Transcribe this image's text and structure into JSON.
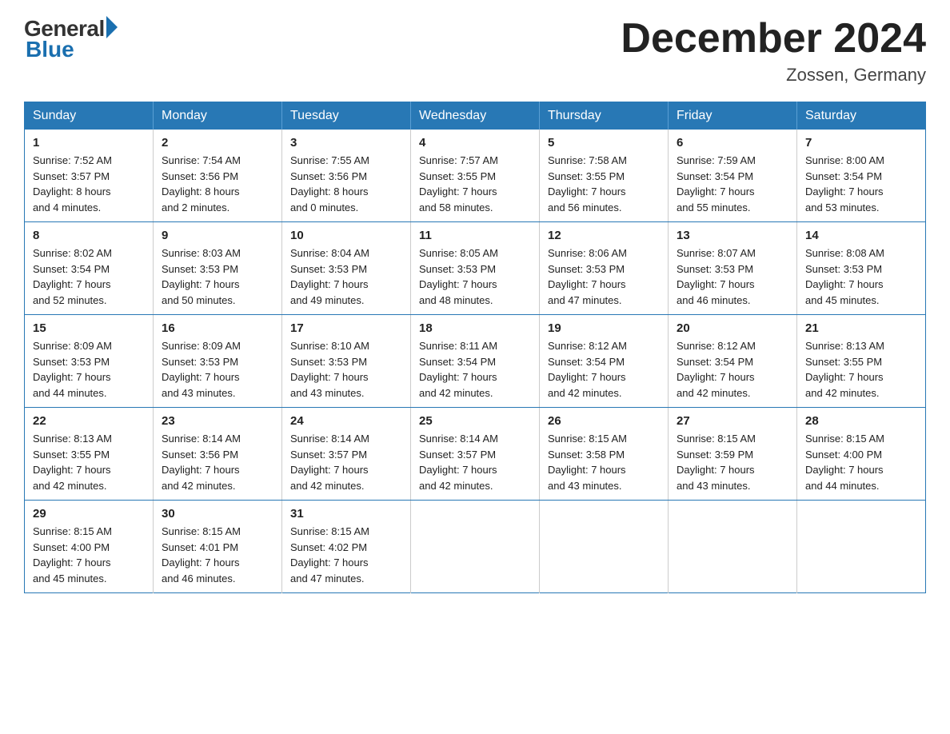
{
  "header": {
    "logo_general": "General",
    "logo_blue": "Blue",
    "month_title": "December 2024",
    "location": "Zossen, Germany"
  },
  "days_of_week": [
    "Sunday",
    "Monday",
    "Tuesday",
    "Wednesday",
    "Thursday",
    "Friday",
    "Saturday"
  ],
  "weeks": [
    [
      {
        "day": "1",
        "sunrise": "7:52 AM",
        "sunset": "3:57 PM",
        "daylight": "8 hours and 4 minutes."
      },
      {
        "day": "2",
        "sunrise": "7:54 AM",
        "sunset": "3:56 PM",
        "daylight": "8 hours and 2 minutes."
      },
      {
        "day": "3",
        "sunrise": "7:55 AM",
        "sunset": "3:56 PM",
        "daylight": "8 hours and 0 minutes."
      },
      {
        "day": "4",
        "sunrise": "7:57 AM",
        "sunset": "3:55 PM",
        "daylight": "7 hours and 58 minutes."
      },
      {
        "day": "5",
        "sunrise": "7:58 AM",
        "sunset": "3:55 PM",
        "daylight": "7 hours and 56 minutes."
      },
      {
        "day": "6",
        "sunrise": "7:59 AM",
        "sunset": "3:54 PM",
        "daylight": "7 hours and 55 minutes."
      },
      {
        "day": "7",
        "sunrise": "8:00 AM",
        "sunset": "3:54 PM",
        "daylight": "7 hours and 53 minutes."
      }
    ],
    [
      {
        "day": "8",
        "sunrise": "8:02 AM",
        "sunset": "3:54 PM",
        "daylight": "7 hours and 52 minutes."
      },
      {
        "day": "9",
        "sunrise": "8:03 AM",
        "sunset": "3:53 PM",
        "daylight": "7 hours and 50 minutes."
      },
      {
        "day": "10",
        "sunrise": "8:04 AM",
        "sunset": "3:53 PM",
        "daylight": "7 hours and 49 minutes."
      },
      {
        "day": "11",
        "sunrise": "8:05 AM",
        "sunset": "3:53 PM",
        "daylight": "7 hours and 48 minutes."
      },
      {
        "day": "12",
        "sunrise": "8:06 AM",
        "sunset": "3:53 PM",
        "daylight": "7 hours and 47 minutes."
      },
      {
        "day": "13",
        "sunrise": "8:07 AM",
        "sunset": "3:53 PM",
        "daylight": "7 hours and 46 minutes."
      },
      {
        "day": "14",
        "sunrise": "8:08 AM",
        "sunset": "3:53 PM",
        "daylight": "7 hours and 45 minutes."
      }
    ],
    [
      {
        "day": "15",
        "sunrise": "8:09 AM",
        "sunset": "3:53 PM",
        "daylight": "7 hours and 44 minutes."
      },
      {
        "day": "16",
        "sunrise": "8:09 AM",
        "sunset": "3:53 PM",
        "daylight": "7 hours and 43 minutes."
      },
      {
        "day": "17",
        "sunrise": "8:10 AM",
        "sunset": "3:53 PM",
        "daylight": "7 hours and 43 minutes."
      },
      {
        "day": "18",
        "sunrise": "8:11 AM",
        "sunset": "3:54 PM",
        "daylight": "7 hours and 42 minutes."
      },
      {
        "day": "19",
        "sunrise": "8:12 AM",
        "sunset": "3:54 PM",
        "daylight": "7 hours and 42 minutes."
      },
      {
        "day": "20",
        "sunrise": "8:12 AM",
        "sunset": "3:54 PM",
        "daylight": "7 hours and 42 minutes."
      },
      {
        "day": "21",
        "sunrise": "8:13 AM",
        "sunset": "3:55 PM",
        "daylight": "7 hours and 42 minutes."
      }
    ],
    [
      {
        "day": "22",
        "sunrise": "8:13 AM",
        "sunset": "3:55 PM",
        "daylight": "7 hours and 42 minutes."
      },
      {
        "day": "23",
        "sunrise": "8:14 AM",
        "sunset": "3:56 PM",
        "daylight": "7 hours and 42 minutes."
      },
      {
        "day": "24",
        "sunrise": "8:14 AM",
        "sunset": "3:57 PM",
        "daylight": "7 hours and 42 minutes."
      },
      {
        "day": "25",
        "sunrise": "8:14 AM",
        "sunset": "3:57 PM",
        "daylight": "7 hours and 42 minutes."
      },
      {
        "day": "26",
        "sunrise": "8:15 AM",
        "sunset": "3:58 PM",
        "daylight": "7 hours and 43 minutes."
      },
      {
        "day": "27",
        "sunrise": "8:15 AM",
        "sunset": "3:59 PM",
        "daylight": "7 hours and 43 minutes."
      },
      {
        "day": "28",
        "sunrise": "8:15 AM",
        "sunset": "4:00 PM",
        "daylight": "7 hours and 44 minutes."
      }
    ],
    [
      {
        "day": "29",
        "sunrise": "8:15 AM",
        "sunset": "4:00 PM",
        "daylight": "7 hours and 45 minutes."
      },
      {
        "day": "30",
        "sunrise": "8:15 AM",
        "sunset": "4:01 PM",
        "daylight": "7 hours and 46 minutes."
      },
      {
        "day": "31",
        "sunrise": "8:15 AM",
        "sunset": "4:02 PM",
        "daylight": "7 hours and 47 minutes."
      },
      null,
      null,
      null,
      null
    ]
  ],
  "labels": {
    "sunrise": "Sunrise:",
    "sunset": "Sunset:",
    "daylight": "Daylight:"
  }
}
